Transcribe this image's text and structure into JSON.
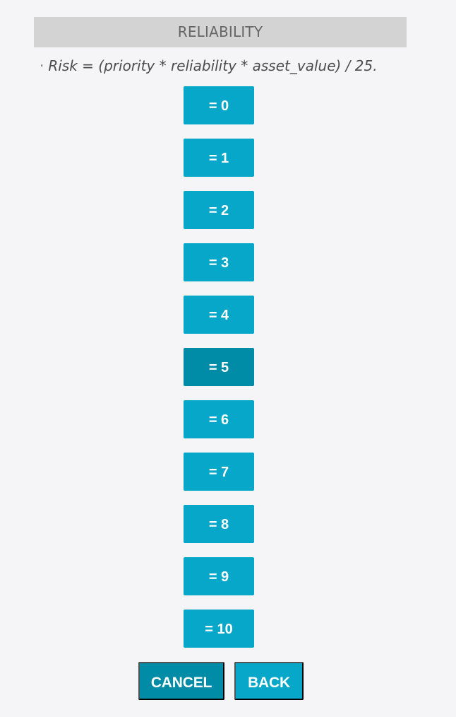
{
  "header": {
    "title": "RELIABILITY"
  },
  "formula": {
    "bullet": "·",
    "text": "Risk = (priority * reliability * asset_value) / 25."
  },
  "options": [
    "= 0",
    "= 1",
    "= 2",
    "= 3",
    "= 4",
    "= 5",
    "= 6",
    "= 7",
    "= 8",
    "= 9",
    "= 10"
  ],
  "selected_option": "= 5",
  "actions": {
    "cancel_label": "CANCEL",
    "back_label": "BACK"
  },
  "colors": {
    "background": "#f5f4f7",
    "header_bg": "#d3d3d3",
    "button_primary": "#06a7c9",
    "button_active": "#008ba6",
    "text_muted": "#666666"
  }
}
